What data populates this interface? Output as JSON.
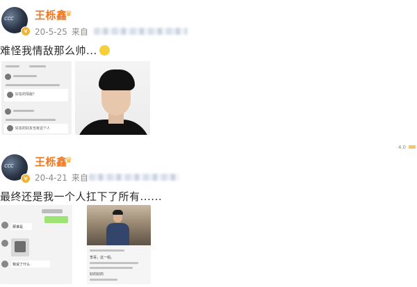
{
  "posts": [
    {
      "username": "王栎鑫",
      "date": "20-5-25",
      "source_label": "来自",
      "text": "难怪我情敌那么帅...",
      "avatar_text": "ccc",
      "screenshot_lines": [
        "好友的情敌？",
        "好友的好友也有这个人"
      ]
    },
    {
      "username": "王栎鑫",
      "date": "20-4-21",
      "source_label": "来自",
      "text": "最终还是我一个人扛下了所有......",
      "avatar_text": "ccc",
      "chat_lines": [
        "那谁是",
        "我说了什么"
      ],
      "photo_lines": [
        "李哥，这一组。",
        "好的好的"
      ]
    }
  ],
  "side_stat": "4.0",
  "colors": {
    "username": "#f0761f",
    "meta": "#8a8a8a",
    "text": "#2a2a2a",
    "vip": "#f2b233"
  },
  "icons": {
    "vip_badge": "v",
    "crown": "♛"
  }
}
